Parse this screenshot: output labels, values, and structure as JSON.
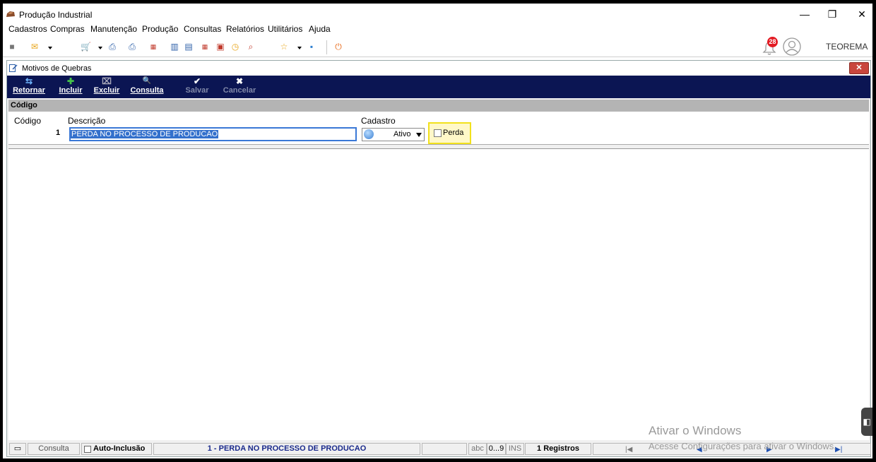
{
  "window": {
    "title": "Produção Industrial"
  },
  "window_controls": {
    "minimize": "—",
    "restore": "❐",
    "close": "✕"
  },
  "menu": [
    "Cadastros",
    "Compras",
    "Manutenção",
    "Produção",
    "Consultas",
    "Relatórios",
    "Utilitários",
    "Ajuda"
  ],
  "header": {
    "notification_count": "28",
    "company": "TEOREMA"
  },
  "child": {
    "title": "Motivos de Quebras",
    "close": "✕",
    "actions": [
      {
        "label": "Retornar",
        "icon": "⇆"
      },
      {
        "label": "Incluir",
        "icon": "✚"
      },
      {
        "label": "Excluir",
        "icon": "⌧"
      },
      {
        "label": "Consulta",
        "icon": "🔍"
      },
      {
        "label": "Salvar",
        "icon": "✔"
      },
      {
        "label": "Cancelar",
        "icon": "✖"
      }
    ],
    "section": "Código",
    "form": {
      "codigo_label": "Código",
      "codigo_value": "1",
      "descricao_label": "Descrição",
      "descricao_value": "PERDA NO PROCESSO DE PRODUCAO",
      "cadastro_label": "Cadastro",
      "cadastro_value": "Ativo",
      "perda_label": "Perda",
      "perda_checked": false
    }
  },
  "status": {
    "mode": "Consulta",
    "auto_inclusao": "Auto-Inclusão",
    "current": "1 - PERDA NO PROCESSO DE PRODUCAO",
    "abc": "abc",
    "num": "0...9",
    "ins": "INS",
    "records": "1 Registros"
  },
  "watermark": {
    "line1": "Ativar o Windows",
    "line2": "Acesse Configurações para ativar o Windows."
  }
}
